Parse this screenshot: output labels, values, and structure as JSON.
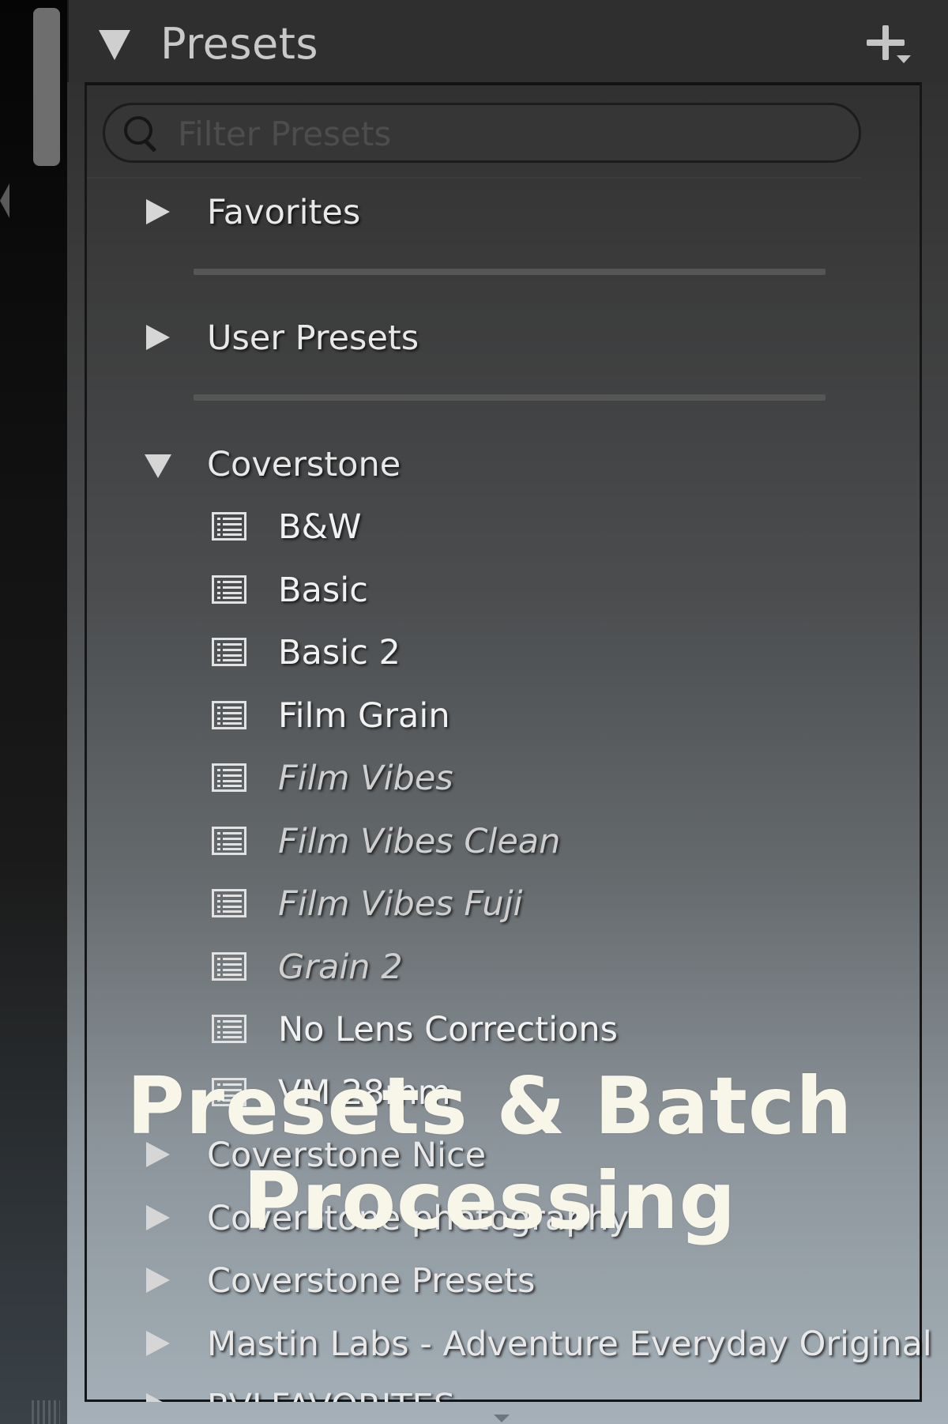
{
  "panel": {
    "title": "Presets",
    "add_icon": "plus-with-caret-icon"
  },
  "search": {
    "placeholder": "Filter Presets",
    "value": ""
  },
  "tree": {
    "folders_top": [
      {
        "label": "Favorites",
        "expanded": false
      },
      {
        "label": "User Presets",
        "expanded": false
      }
    ],
    "open_folder": {
      "label": "Coverstone",
      "expanded": true,
      "presets": [
        {
          "label": "B&W",
          "style": "normal"
        },
        {
          "label": "Basic",
          "style": "normal"
        },
        {
          "label": "Basic 2",
          "style": "normal"
        },
        {
          "label": "Film Grain",
          "style": "normal"
        },
        {
          "label": "Film Vibes",
          "style": "italic"
        },
        {
          "label": "Film Vibes Clean",
          "style": "italic"
        },
        {
          "label": "Film Vibes Fuji",
          "style": "italic"
        },
        {
          "label": "Grain 2",
          "style": "italic"
        },
        {
          "label": "No Lens Corrections",
          "style": "normal"
        },
        {
          "label": "VM 28mm",
          "style": "normal"
        }
      ]
    },
    "folders_bottom": [
      {
        "label": "Coverstone Nice",
        "expanded": false
      },
      {
        "label": "Coverstone photography",
        "expanded": false
      },
      {
        "label": "Coverstone Presets",
        "expanded": false
      },
      {
        "label": "Mastin Labs - Adventure Everyday Original",
        "expanded": false
      },
      {
        "label": "RVLFAVORITES",
        "expanded": false
      }
    ]
  },
  "overlay": {
    "line1": "Presets & Batch",
    "line2": "Processing"
  },
  "colors": {
    "panel_header": "#2f2f2f",
    "text_primary": "#e8e8e8",
    "overlay_text": "#f8f6e8"
  }
}
